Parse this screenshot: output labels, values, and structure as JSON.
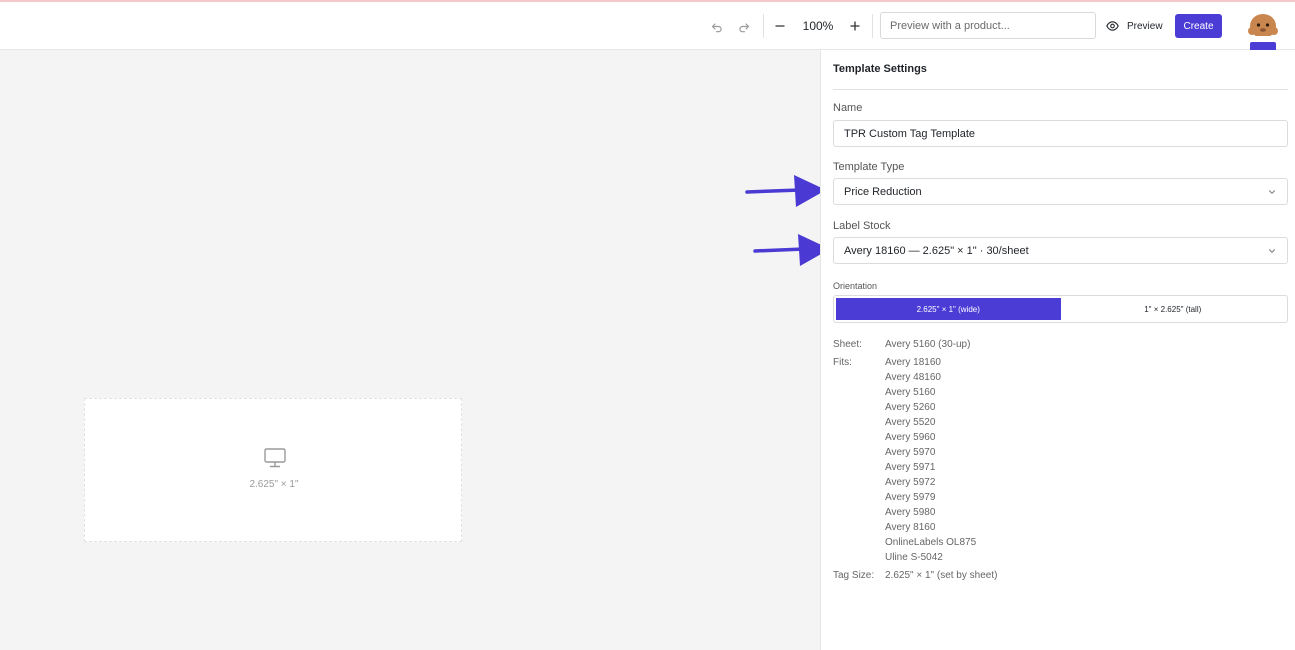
{
  "toolbar": {
    "zoom_level": "100%",
    "preview_placeholder": "Preview with a product...",
    "preview_label": "Preview",
    "create_label": "Create"
  },
  "canvas": {
    "label_size": "2.625\" × 1\""
  },
  "panel": {
    "title": "Template Settings",
    "name_label": "Name",
    "name_value": "TPR Custom Tag Template",
    "template_type_label": "Template Type",
    "template_type_value": "Price Reduction",
    "label_stock_label": "Label Stock",
    "label_stock_value": "Avery 18160 — 2.625\" × 1\" · 30/sheet",
    "orientation_label": "Orientation",
    "orientation_options": [
      "2.625\" × 1\" (wide)",
      "1\" × 2.625\" (tall)"
    ],
    "orientation_selected": "2.625\" × 1\" (wide)",
    "sheet_label": "Sheet:",
    "sheet_value": "Avery 5160 (30-up)",
    "fits_label": "Fits:",
    "fits": [
      "Avery 18160",
      "Avery 48160",
      "Avery 5160",
      "Avery 5260",
      "Avery 5520",
      "Avery 5960",
      "Avery 5970",
      "Avery 5971",
      "Avery 5972",
      "Avery 5979",
      "Avery 5980",
      "Avery 8160",
      "OnlineLabels OL875",
      "Uline S-5042"
    ],
    "tag_size_label": "Tag Size:",
    "tag_size_value": "2.625\" × 1\" (set by sheet)"
  },
  "colors": {
    "accent": "#4c3cd6",
    "canvas_bg": "#f4f4f4",
    "annotation_arrow": "#4a3ad3"
  },
  "icons": [
    "undo-icon",
    "redo-icon",
    "minus-icon",
    "plus-icon",
    "eye-icon",
    "monitor-icon",
    "chevron-down-icon",
    "avatar"
  ]
}
